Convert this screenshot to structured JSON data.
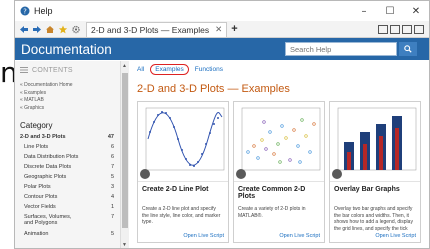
{
  "edge_glyph": "n",
  "window": {
    "title": "Help",
    "controls": {
      "minimize": "–",
      "maximize": "☐",
      "close": "✕"
    }
  },
  "toolbar": {
    "tab_label": "2-D and 3-D Plots — Examples",
    "tab_close": "✕",
    "tab_add": "+"
  },
  "header": {
    "title": "Documentation",
    "search_placeholder": "Search Help"
  },
  "sidebar": {
    "contents_label": "CONTENTS",
    "breadcrumbs": [
      "« Documentation Home",
      "« Examples",
      "« MATLAB",
      "« Graphics"
    ],
    "category_heading": "Category",
    "categories": [
      {
        "label": "2-D and 3-D Plots",
        "count": "47"
      },
      {
        "label": "Line Plots",
        "count": "6"
      },
      {
        "label": "Data Distribution Plots",
        "count": "6"
      },
      {
        "label": "Discrete Data Plots",
        "count": "7"
      },
      {
        "label": "Geographic Plots",
        "count": "5"
      },
      {
        "label": "Polar Plots",
        "count": "3"
      },
      {
        "label": "Contour Plots",
        "count": "4"
      },
      {
        "label": "Vector Fields",
        "count": "1"
      },
      {
        "label": "Surfaces, Volumes, and Polygons",
        "count": "7"
      },
      {
        "label": "Animation",
        "count": "5"
      }
    ]
  },
  "main": {
    "filters": {
      "all": "All",
      "examples": "Examples",
      "functions": "Functions"
    },
    "heading": "2-D and 3-D Plots — Examples",
    "cards": [
      {
        "title": "Create 2-D Line Plot",
        "description": "Create a 2-D line plot and specify the line style, line color, and marker type.",
        "link": "Open Live Script"
      },
      {
        "title": "Create Common 2-D Plots",
        "description": "Create a variety of 2-D plots in MATLAB®.",
        "link": "Open Live Script"
      },
      {
        "title": "Overlay Bar Graphs",
        "description": "Overlay two bar graphs and specify the bar colors and widths. Then, it shows how to add a legend, display the grid lines, and specify the tick",
        "link": "Open Live Script"
      }
    ]
  },
  "colors": {
    "header_blue": "#2767a7",
    "heading_orange": "#c35a12",
    "link_blue": "#1a6ec0",
    "highlight_red": "#dd2222",
    "bar_dark": "#1f3f7a",
    "bar_red": "#b52727"
  }
}
